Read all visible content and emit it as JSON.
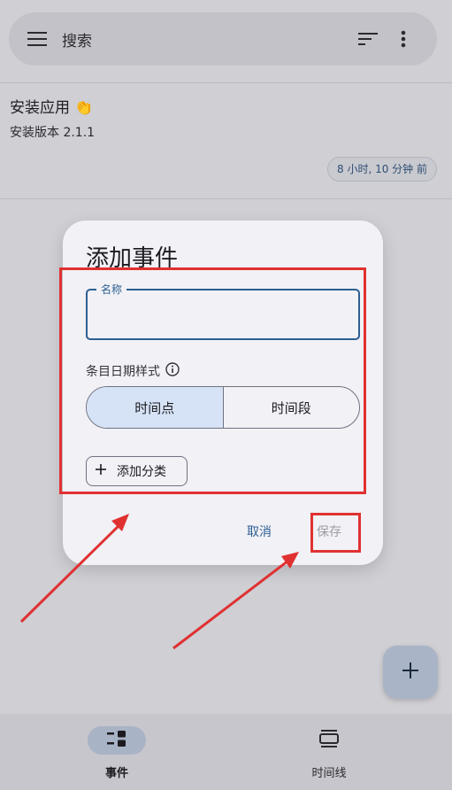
{
  "search": {
    "placeholder": "搜索"
  },
  "event": {
    "title": "安装应用 👏",
    "subtitle": "安装版本 2.1.1",
    "time_ago": "8 小时, 10 分钟 前"
  },
  "dialog": {
    "title": "添加事件",
    "name_label": "名称",
    "name_value": "",
    "date_style_label": "条目日期样式",
    "segments": [
      "时间点",
      "时间段"
    ],
    "selected_segment": "时间点",
    "add_category_label": "添加分类",
    "cancel_label": "取消",
    "save_label": "保存"
  },
  "nav": {
    "items": [
      {
        "label": "事件"
      },
      {
        "label": "时间线"
      }
    ],
    "active": "事件"
  },
  "icons": [
    "menu-icon",
    "sort-icon",
    "more-vert-icon",
    "info-icon",
    "add-icon",
    "events-icon",
    "timeline-icon"
  ],
  "colors": {
    "accent": "#2d5f92",
    "annotation": "#e03131",
    "selected_segment": "#d6e3f7"
  }
}
